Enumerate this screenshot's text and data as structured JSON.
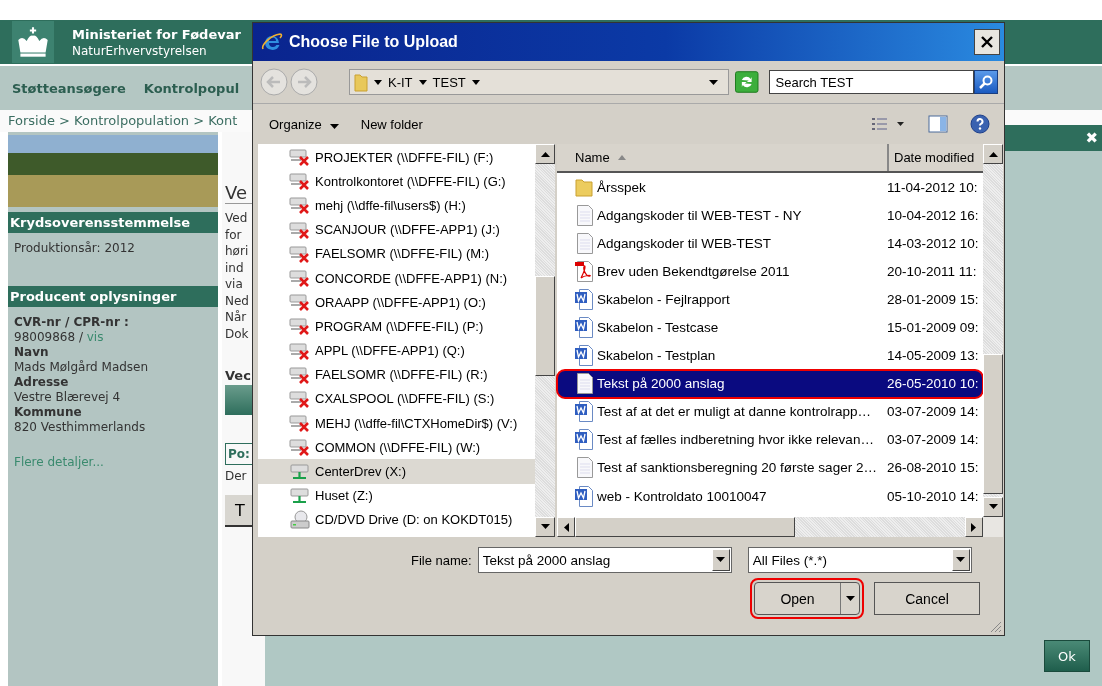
{
  "site": {
    "title": "Ministeriet for Fødevar",
    "subtitle": "NaturErhvervstyrelsen",
    "nav": [
      {
        "label": "Støtteansøgere"
      },
      {
        "label": "Kontrolpopul"
      }
    ],
    "breadcrumb": "Forside > Kontrolpopulation > Kont",
    "sidebar": {
      "section_1": {
        "heading": "Krydsoverensstemmelse",
        "text": "Produktionsår: 2012"
      },
      "section_2": {
        "heading": "Producent oplysninger",
        "fields": [
          {
            "label": "CVR-nr / CPR-nr :",
            "value": "98009868 / ",
            "link": "vis"
          },
          {
            "label": "Navn",
            "value": "Mads Mølgård Madsen"
          },
          {
            "label": "Adresse",
            "value": "Vestre Blærevej 4"
          },
          {
            "label": "Kommune",
            "value": "820 Vesthimmerlands"
          }
        ],
        "more_link": "Flere detaljer..."
      }
    },
    "content": {
      "heading": "Ve",
      "lines": [
        "Ved",
        "for",
        "høri",
        "ind",
        "via",
        "Ned",
        "Når",
        "Dok"
      ],
      "subheading": "Vec",
      "tab": "Po:",
      "note": "Der",
      "button": "T"
    },
    "modal": {
      "close": "✖",
      "ok_button": "Ok"
    }
  },
  "dialog": {
    "title": "Choose File to Upload",
    "path": [
      "K-IT",
      "TEST"
    ],
    "search": {
      "placeholder": "Search TEST"
    },
    "toolbar": [
      "Organize",
      "New folder"
    ],
    "tree": [
      {
        "label": "PROJEKTER (\\\\DFFE-FIL) (F:)",
        "kind": "offline-drive",
        "selected": false
      },
      {
        "label": "Kontrolkontoret (\\\\DFFE-FIL) (G:)",
        "kind": "offline-drive",
        "selected": false
      },
      {
        "label": "mehj (\\\\dffe-fil\\users$) (H:)",
        "kind": "offline-drive",
        "selected": false
      },
      {
        "label": "SCANJOUR (\\\\DFFE-APP1) (J:)",
        "kind": "offline-drive",
        "selected": false
      },
      {
        "label": "FAELSOMR (\\\\DFFE-FIL) (M:)",
        "kind": "offline-drive",
        "selected": false
      },
      {
        "label": "CONCORDE (\\\\DFFE-APP1) (N:)",
        "kind": "offline-drive",
        "selected": false
      },
      {
        "label": "ORAAPP (\\\\DFFE-APP1) (O:)",
        "kind": "offline-drive",
        "selected": false
      },
      {
        "label": "PROGRAM (\\\\DFFE-FIL) (P:)",
        "kind": "offline-drive",
        "selected": false
      },
      {
        "label": "APPL (\\\\DFFE-APP1) (Q:)",
        "kind": "offline-drive",
        "selected": false
      },
      {
        "label": "FAELSOMR (\\\\DFFE-FIL) (R:)",
        "kind": "offline-drive",
        "selected": false
      },
      {
        "label": "CXALSPOOL (\\\\DFFE-FIL) (S:)",
        "kind": "offline-drive",
        "selected": false
      },
      {
        "label": "MEHJ (\\\\dffe-fil\\CTXHomeDir$) (V:)",
        "kind": "offline-drive",
        "selected": false
      },
      {
        "label": "COMMON (\\\\DFFE-FIL) (W:)",
        "kind": "offline-drive",
        "selected": false
      },
      {
        "label": "CenterDrev (X:)",
        "kind": "drive",
        "selected": true
      },
      {
        "label": "Huset (Z:)",
        "kind": "drive",
        "selected": false
      },
      {
        "label": "CD/DVD Drive (D: on KOKDT015)",
        "kind": "cd-drive",
        "selected": false
      }
    ],
    "columns": [
      "Name",
      "Date modified"
    ],
    "files": [
      {
        "name": "Årsspek",
        "date": "11-04-2012 10:",
        "kind": "folder",
        "selected": false,
        "highlighted": false
      },
      {
        "name": "Adgangskoder til WEB-TEST - NY",
        "date": "10-04-2012 16:",
        "kind": "text",
        "selected": false,
        "highlighted": false
      },
      {
        "name": "Adgangskoder til WEB-TEST",
        "date": "14-03-2012 10:",
        "kind": "text",
        "selected": false,
        "highlighted": false
      },
      {
        "name": "Brev uden Bekendtgørelse 2011",
        "date": "20-10-2011 11:",
        "kind": "pdf",
        "selected": false,
        "highlighted": false
      },
      {
        "name": "Skabelon - Fejlrapport",
        "date": "28-01-2009 15:",
        "kind": "word",
        "selected": false,
        "highlighted": false
      },
      {
        "name": "Skabelon - Testcase",
        "date": "15-01-2009 09:",
        "kind": "word",
        "selected": false,
        "highlighted": false
      },
      {
        "name": "Skabelon - Testplan",
        "date": "14-05-2009 13:",
        "kind": "word",
        "selected": false,
        "highlighted": false
      },
      {
        "name": "Tekst på 2000 anslag",
        "date": "26-05-2010 10:",
        "kind": "text",
        "selected": true,
        "highlighted": true
      },
      {
        "name": "Test af at det er muligt at danne kontrolrapp…",
        "date": "03-07-2009 14:",
        "kind": "word",
        "selected": false,
        "highlighted": false
      },
      {
        "name": "Test af fælles indberetning hvor ikke relevan…",
        "date": "03-07-2009 14:",
        "kind": "word",
        "selected": false,
        "highlighted": false
      },
      {
        "name": "Test af sanktionsberegning 20 første sager 2…",
        "date": "26-08-2010 15:",
        "kind": "text",
        "selected": false,
        "highlighted": false
      },
      {
        "name": "web - Kontroldato 10010047",
        "date": "05-10-2010 14:",
        "kind": "word",
        "selected": false,
        "highlighted": false
      }
    ],
    "file_name_label": "File name:",
    "file_name": "Tekst på 2000 anslag",
    "file_type": "All Files (*.*)",
    "buttons": [
      {
        "label": "Open",
        "split": true,
        "highlighted": true
      },
      {
        "label": "Cancel",
        "split": false,
        "highlighted": false
      }
    ]
  }
}
